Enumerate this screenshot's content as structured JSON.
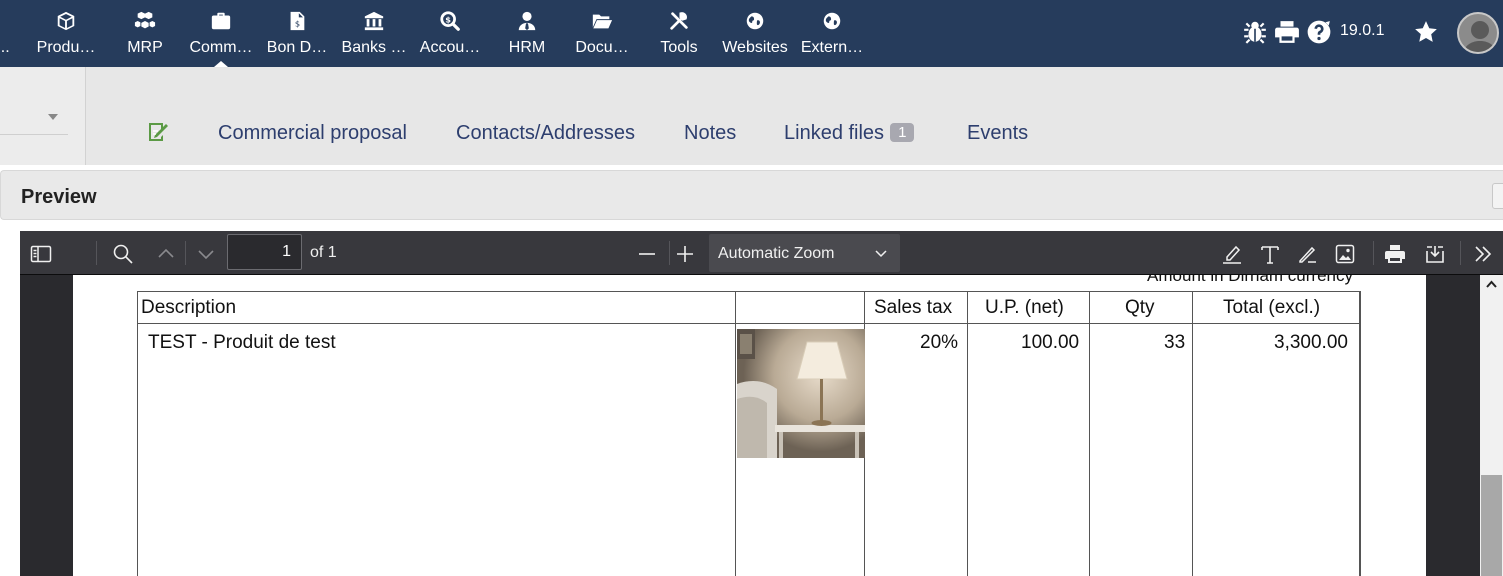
{
  "topnav": {
    "items": [
      {
        "label": "...",
        "icon": "ellipsis-icon"
      },
      {
        "label": "Produ…",
        "icon": "cube-icon"
      },
      {
        "label": "MRP",
        "icon": "cubes-icon"
      },
      {
        "label": "Comm…",
        "icon": "briefcase-icon",
        "active": true
      },
      {
        "label": "Bon D…",
        "icon": "invoice-icon"
      },
      {
        "label": "Banks …",
        "icon": "bank-icon"
      },
      {
        "label": "Accou…",
        "icon": "search-dollar-icon"
      },
      {
        "label": "HRM",
        "icon": "user-tie-icon"
      },
      {
        "label": "Docu…",
        "icon": "folder-open-icon"
      },
      {
        "label": "Tools",
        "icon": "tools-icon"
      },
      {
        "label": "Websites",
        "icon": "globe-icon"
      },
      {
        "label": "Extern…",
        "icon": "globe-icon"
      }
    ],
    "version": "19.0.1",
    "right_icons": [
      "bug-icon",
      "print-icon",
      "help-icon",
      "star-icon",
      "avatar"
    ]
  },
  "tabs": {
    "items": [
      {
        "label": "Commercial proposal"
      },
      {
        "label": "Contacts/Addresses"
      },
      {
        "label": "Notes"
      },
      {
        "label": "Linked files",
        "badge": "1"
      },
      {
        "label": "Events"
      }
    ]
  },
  "preview": {
    "title": "Preview"
  },
  "pdf_toolbar": {
    "page_number": "1",
    "page_of": "of 1",
    "zoom": "Automatic Zoom"
  },
  "document": {
    "amount_note": "Amount in Dirham currency",
    "columns": [
      "Description",
      "",
      "Sales tax",
      "U.P. (net)",
      "Qty",
      "Total (excl.)"
    ],
    "rows": [
      {
        "description": "TEST - Produit de test",
        "image": "table-lamp-photo",
        "sales_tax": "20%",
        "unit_price": "100.00",
        "qty": "33",
        "total": "3,300.00"
      }
    ]
  },
  "colors": {
    "topbar": "#263c5c",
    "tab_text": "#2d3e6e",
    "viewer_bg": "#2a2a2e",
    "viewer_toolbar": "#38383d"
  }
}
